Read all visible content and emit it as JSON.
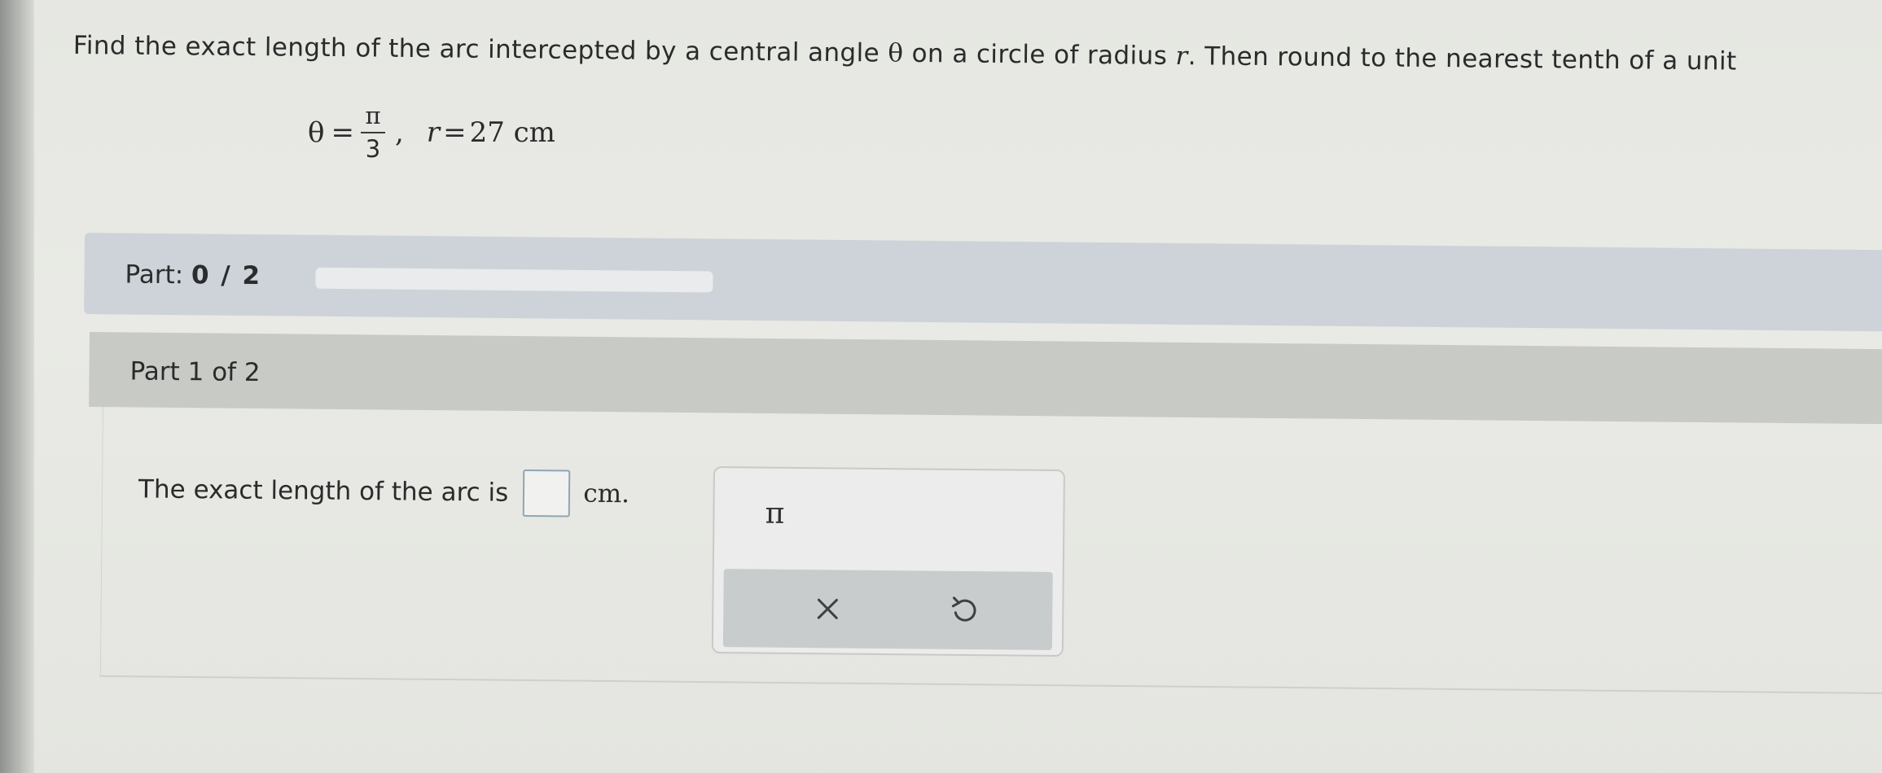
{
  "question": {
    "text_before_theta": "Find the exact length of the arc intercepted by a central angle ",
    "theta_symbol": "θ",
    "text_between": " on a circle of radius ",
    "radius_symbol": "r",
    "text_after": ". Then round to the nearest tenth of a unit"
  },
  "formula": {
    "theta": "θ",
    "equals": "=",
    "numerator": "π",
    "denominator": "3",
    "separator": ",",
    "r": "r",
    "r_equals": "=",
    "r_value": "27 cm"
  },
  "status": {
    "label": "Part: ",
    "progress": "0 / 2",
    "progress_fraction": 0
  },
  "part_header": "Part 1 of 2",
  "answer": {
    "prompt": "The exact length of the arc is",
    "unit": "cm."
  },
  "tools": {
    "pi_symbol": "π",
    "clear_icon": "close-icon",
    "undo_icon": "undo-icon"
  },
  "colors": {
    "accent": "#4b9fd1",
    "input_border": "#8fa6b6"
  }
}
